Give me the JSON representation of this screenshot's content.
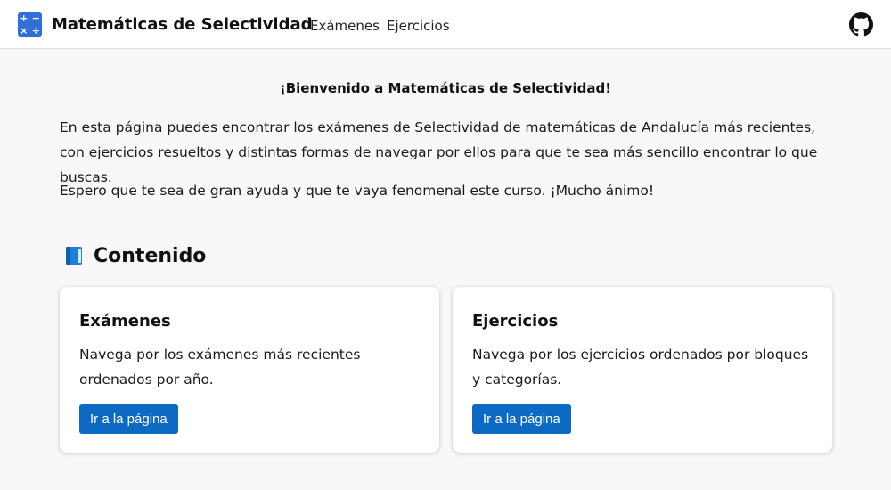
{
  "header": {
    "brand": "Matemáticas de Selectividad",
    "logo_symbols": [
      "+",
      "−",
      "×",
      "÷"
    ],
    "nav": [
      {
        "label": "Exámenes"
      },
      {
        "label": "Ejercicios"
      }
    ],
    "github_icon": "github-icon"
  },
  "main": {
    "welcome_title": "¡Bienvenido a Matemáticas de Selectividad!",
    "paragraph_1": "En esta página puedes encontrar los exámenes de Selectividad de matemáticas de Andalucía más recientes, con ejercicios resueltos y distintas formas de navegar por ellos para que te sea más sencillo encontrar lo que buscas.",
    "paragraph_2": "Espero que te sea de gran ayuda y que te vaya fenomenal este curso. ¡Mucho ánimo!",
    "section_title": "Contenido",
    "section_icon": "book-icon",
    "cards": [
      {
        "title": "Exámenes",
        "description": "Navega por los exámenes más recientes ordenados por año.",
        "button_label": "Ir a la página"
      },
      {
        "title": "Ejercicios",
        "description": "Navega por los ejercicios ordenados por bloques y categorías.",
        "button_label": "Ir a la página"
      }
    ]
  },
  "colors": {
    "background": "#f8f8f8",
    "accent": "#0d6ac4",
    "logo": "#2f6fd6"
  }
}
